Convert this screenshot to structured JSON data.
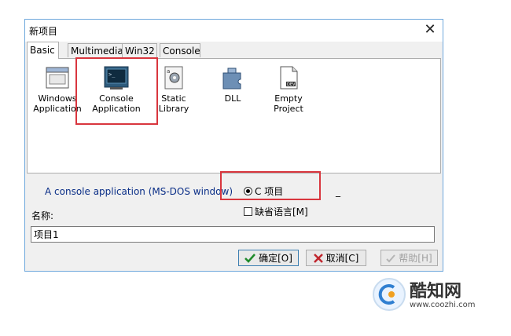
{
  "window": {
    "title": "新项目",
    "close_label": "✕"
  },
  "tabs": [
    {
      "label": "Basic",
      "active": true
    },
    {
      "label": "Multimedia",
      "active": false
    },
    {
      "label": "Win32",
      "active": false
    },
    {
      "label": "Console",
      "active": false
    }
  ],
  "templates": [
    {
      "label_line1": "Windows",
      "label_line2": "Application",
      "icon": "windows-app-icon"
    },
    {
      "label_line1": "Console",
      "label_line2": "Application",
      "icon": "console-app-icon",
      "selected": true
    },
    {
      "label_line1": "Static Library",
      "label_line2": "",
      "icon": "static-library-icon"
    },
    {
      "label_line1": "DLL",
      "label_line2": "",
      "icon": "dll-icon"
    },
    {
      "label_line1": "Empty Project",
      "label_line2": "",
      "icon": "empty-project-icon"
    }
  ],
  "description": "A console application (MS-DOS window)",
  "language": {
    "option_label": "C 项目",
    "selected": true,
    "cpp_label": "_"
  },
  "default_language": {
    "label": "缺省语言[M]",
    "checked": false
  },
  "name": {
    "label": "名称:",
    "value": "项目1"
  },
  "buttons": {
    "ok": "确定[O]",
    "cancel": "取消[C]",
    "help": "帮助[H]"
  },
  "watermark": {
    "brand": "酷知网",
    "url": "www.coozhi.com"
  },
  "colors": {
    "highlight": "#d9363e",
    "description_text": "#0a2e87",
    "dialog_border": "#6fa8dc"
  }
}
